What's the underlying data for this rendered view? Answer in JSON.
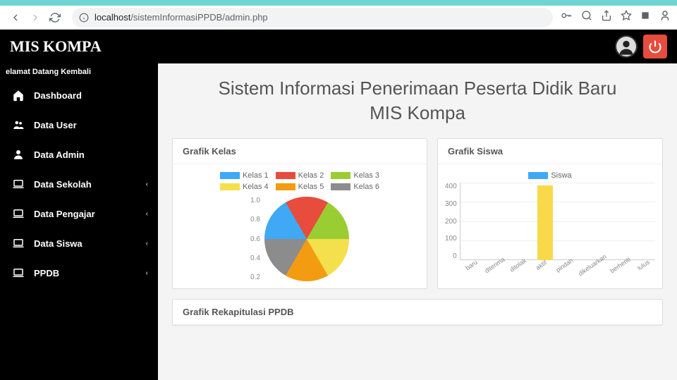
{
  "browser": {
    "url_host": "localhost",
    "url_path": "/sistemInformasiPPDB/admin.php"
  },
  "header": {
    "title": "MIS KOMPA"
  },
  "sidebar": {
    "welcome": "elamat Datang Kembali",
    "items": [
      {
        "label": "Dashboard",
        "icon": "home",
        "expandable": false
      },
      {
        "label": "Data User",
        "icon": "users",
        "expandable": false
      },
      {
        "label": "Data Admin",
        "icon": "user",
        "expandable": false
      },
      {
        "label": "Data Sekolah",
        "icon": "laptop",
        "expandable": true
      },
      {
        "label": "Data Pengajar",
        "icon": "laptop",
        "expandable": true
      },
      {
        "label": "Data Siswa",
        "icon": "laptop",
        "expandable": true
      },
      {
        "label": "PPDB",
        "icon": "laptop",
        "expandable": true
      }
    ]
  },
  "main": {
    "title": "Sistem Informasi Penerimaan Peserta Didik Baru",
    "subtitle": "MIS Kompa"
  },
  "panels": {
    "kelas": {
      "title": "Grafik Kelas"
    },
    "siswa": {
      "title": "Grafik Siswa"
    },
    "rekap": {
      "title": "Grafik Rekapitulasi PPDB"
    }
  },
  "chart_data": [
    {
      "id": "kelas",
      "type": "pie",
      "title": "Grafik Kelas",
      "series": [
        {
          "name": "Kelas 1",
          "value": 1,
          "color": "#3fa9f5"
        },
        {
          "name": "Kelas 2",
          "value": 1,
          "color": "#e74c3c"
        },
        {
          "name": "Kelas 3",
          "value": 1,
          "color": "#9acd32"
        },
        {
          "name": "Kelas 4",
          "value": 1,
          "color": "#f4e04d"
        },
        {
          "name": "Kelas 5",
          "value": 1,
          "color": "#f39c12"
        },
        {
          "name": "Kelas 6",
          "value": 1,
          "color": "#8c8c8c"
        }
      ],
      "y_ticks": [
        "1.0",
        "0.8",
        "0.6",
        "0.4",
        "0.2"
      ]
    },
    {
      "id": "siswa",
      "type": "bar",
      "title": "Grafik Siswa",
      "legend": "Siswa",
      "legend_color": "#3fa9f5",
      "categories": [
        "baru",
        "diterima",
        "ditolak",
        "aktif",
        "pindah",
        "dikeluarkan",
        "berhenti",
        "lulus"
      ],
      "values": [
        0,
        0,
        0,
        385,
        0,
        0,
        0,
        0
      ],
      "ylim": [
        0,
        400
      ],
      "y_ticks": [
        400,
        300,
        200,
        100,
        0
      ],
      "bar_color": "#f9d949"
    }
  ]
}
